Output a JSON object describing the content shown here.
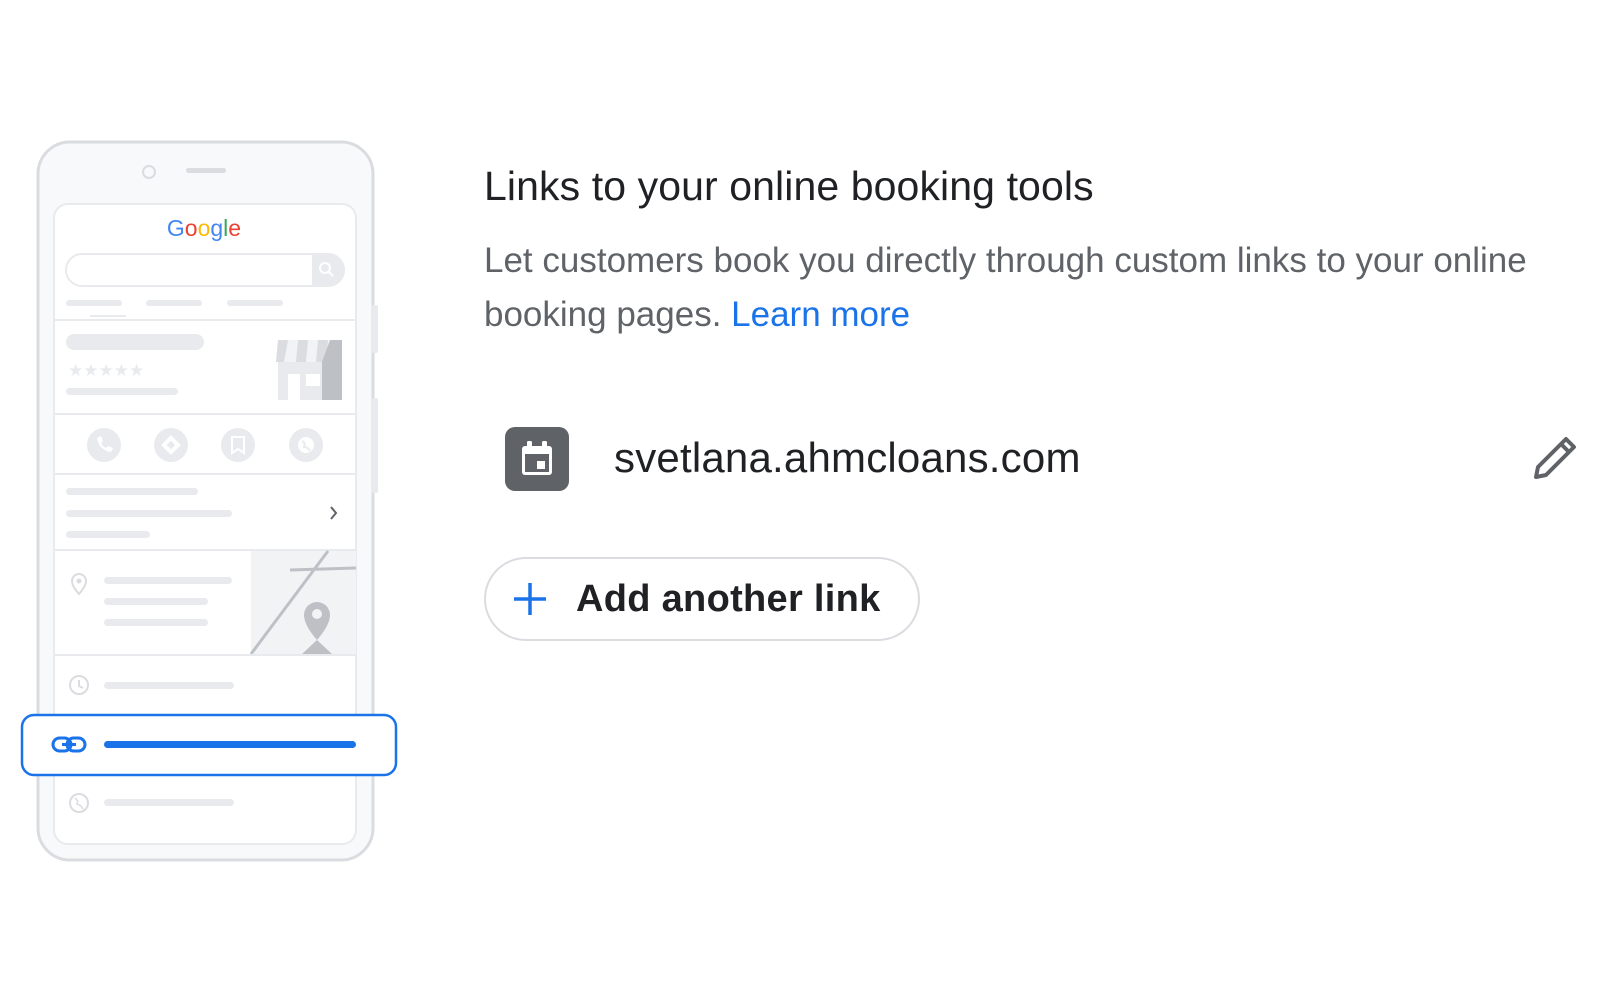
{
  "illustration": {
    "search_engine_logo": "Google",
    "logo_colors": [
      "#4285F4",
      "#EA4335",
      "#FBBC05",
      "#4285F4",
      "#34A853",
      "#EA4335"
    ],
    "highlight_color": "#1a73e8",
    "icons": [
      "phone-icon",
      "directions-icon",
      "bookmark-icon",
      "globe-icon",
      "location-pin-icon",
      "clock-icon",
      "link-icon",
      "globe-icon"
    ]
  },
  "section": {
    "title": "Links to your online booking tools",
    "description": "Let customers book you directly through custom links to your online booking pages.",
    "learn_more": "Learn more"
  },
  "booking_link": {
    "url": "svetlana.ahmcloans.com",
    "icon": "calendar-icon",
    "edit_icon": "pencil-icon"
  },
  "add_link_button": {
    "label": "Add another link",
    "icon": "plus-icon"
  },
  "colors": {
    "accent": "#1a73e8",
    "text_primary": "#202124",
    "text_secondary": "#5f6368",
    "border": "#dadce0"
  }
}
